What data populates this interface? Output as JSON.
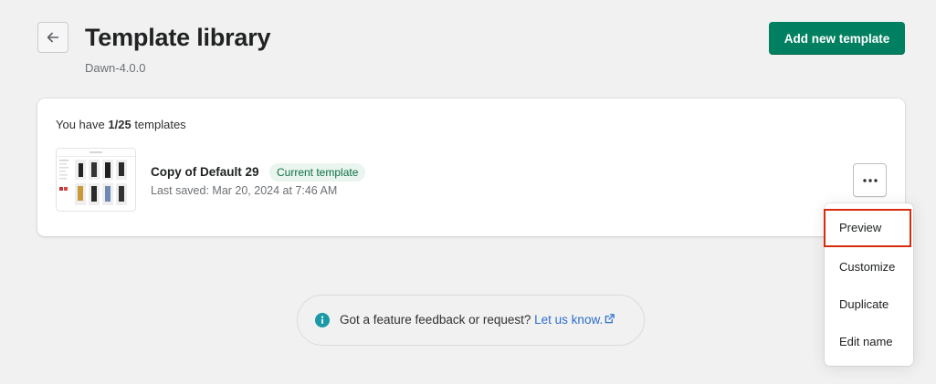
{
  "header": {
    "title": "Template library",
    "subtitle": "Dawn-4.0.0",
    "primary_action": "Add new template",
    "back_icon": "arrow-left-icon"
  },
  "card": {
    "count_prefix": "You have",
    "count_value": "1/25",
    "count_suffix": "templates",
    "template": {
      "name": "Copy of Default 29",
      "badge": "Current template",
      "last_saved": "Last saved: Mar 20, 2024 at 7:46 AM"
    }
  },
  "menu": {
    "items": [
      "Preview",
      "Customize",
      "Duplicate",
      "Edit name"
    ],
    "highlighted_index": 0
  },
  "feedback": {
    "text": "Got a feature feedback or request?",
    "link": "Let us know.",
    "icon": "info-icon"
  },
  "colors": {
    "primary": "#008060",
    "badge_bg": "#e9f5ee",
    "badge_text": "#0e6e47",
    "highlight": "#d72c0d",
    "link": "#2c6ecb",
    "info": "#1a9aa6"
  }
}
